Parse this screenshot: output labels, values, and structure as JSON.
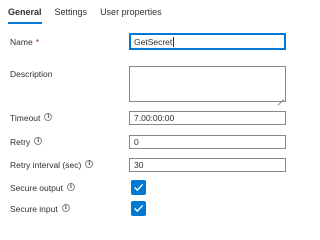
{
  "tabs": [
    {
      "label": "General",
      "active": true
    },
    {
      "label": "Settings",
      "active": false
    },
    {
      "label": "User properties",
      "active": false
    }
  ],
  "form": {
    "name": {
      "label": "Name",
      "required_mark": "*",
      "value": "GetSecret"
    },
    "description": {
      "label": "Description",
      "value": ""
    },
    "timeout": {
      "label": "Timeout",
      "value": "7.00:00:00"
    },
    "retry": {
      "label": "Retry",
      "value": "0"
    },
    "retry_interval": {
      "label": "Retry interval (sec)",
      "value": "30"
    },
    "secure_output": {
      "label": "Secure output",
      "checked": true
    },
    "secure_input": {
      "label": "Secure input",
      "checked": true
    }
  },
  "colors": {
    "accent": "#0078d4",
    "required": "#a4262c",
    "border": "#8a8886",
    "text": "#323130"
  },
  "icons": [
    "info-icon",
    "checkmark-icon",
    "resize-grip-icon"
  ]
}
